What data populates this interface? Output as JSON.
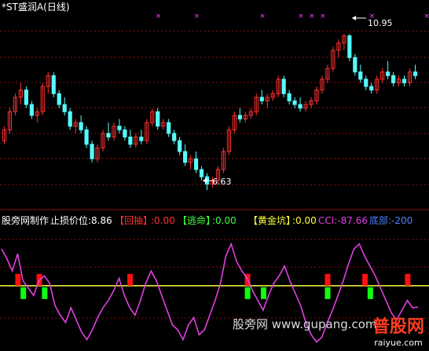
{
  "header": {
    "title": "*ST盛润A(日线)"
  },
  "colors": {
    "bg": "#000000",
    "up": "#ff3030",
    "down": "#54fcfc",
    "grid": "#8a1010",
    "magenta": "#ff40ff",
    "cci": "#e040e0",
    "zero_line": "#ffff40",
    "red_block": "#ff1010",
    "green_block": "#10ff10",
    "white": "#ffffff"
  },
  "annotations": {
    "high_label": "10.95",
    "low_label": "6.63"
  },
  "indicator_row": {
    "label_a": "股旁网制作",
    "label_b": "止损价位:8.86",
    "label_c": "【回抽】",
    "value_c": ":0.00",
    "label_d": "【逃命】",
    "value_d": ":0.00",
    "label_e": "【黄金坑】",
    "value_e": ":0.00",
    "label_f": "CCI:-87.66",
    "label_g": "底部:-200"
  },
  "watermark": {
    "text": "股旁网  www.gupang.com",
    "logo": "普股网",
    "logo_sub": "raiyue.com"
  },
  "chart_data": [
    {
      "type": "candlestick",
      "title": "*ST盛润A(日线)",
      "annotations": [
        {
          "text": "10.95",
          "kind": "high"
        },
        {
          "text": "6.63",
          "kind": "low"
        }
      ],
      "ylim": [
        6.2,
        11.5
      ],
      "candles": [
        [
          8.0,
          8.4,
          7.9,
          8.3
        ],
        [
          8.3,
          8.9,
          8.2,
          8.8
        ],
        [
          8.8,
          9.3,
          8.7,
          9.2
        ],
        [
          9.2,
          9.6,
          9.0,
          9.4
        ],
        [
          9.4,
          9.5,
          8.9,
          9.0
        ],
        [
          9.0,
          9.1,
          8.6,
          8.7
        ],
        [
          8.7,
          8.9,
          8.5,
          8.8
        ],
        [
          8.8,
          9.6,
          8.7,
          9.5
        ],
        [
          9.5,
          9.9,
          9.3,
          9.8
        ],
        [
          9.8,
          9.9,
          9.2,
          9.3
        ],
        [
          9.3,
          9.4,
          8.9,
          9.0
        ],
        [
          9.0,
          9.2,
          8.7,
          8.8
        ],
        [
          8.8,
          8.9,
          8.3,
          8.4
        ],
        [
          8.4,
          8.6,
          8.2,
          8.5
        ],
        [
          8.5,
          8.7,
          8.2,
          8.3
        ],
        [
          8.3,
          8.4,
          7.8,
          7.9
        ],
        [
          7.9,
          8.0,
          7.4,
          7.5
        ],
        [
          7.5,
          7.9,
          7.4,
          7.8
        ],
        [
          7.8,
          8.3,
          7.7,
          8.2
        ],
        [
          8.2,
          8.5,
          8.0,
          8.1
        ],
        [
          8.1,
          8.5,
          8.0,
          8.4
        ],
        [
          8.4,
          8.6,
          8.2,
          8.3
        ],
        [
          8.3,
          8.4,
          8.0,
          8.1
        ],
        [
          8.1,
          8.3,
          7.8,
          7.9
        ],
        [
          7.9,
          8.2,
          7.8,
          8.1
        ],
        [
          8.1,
          8.3,
          7.9,
          8.0
        ],
        [
          8.0,
          8.6,
          7.9,
          8.5
        ],
        [
          8.5,
          8.9,
          8.4,
          8.8
        ],
        [
          8.8,
          8.9,
          8.3,
          8.4
        ],
        [
          8.4,
          8.6,
          8.3,
          8.5
        ],
        [
          8.5,
          8.6,
          8.1,
          8.2
        ],
        [
          8.2,
          8.3,
          7.9,
          8.0
        ],
        [
          8.0,
          8.1,
          7.6,
          7.7
        ],
        [
          7.7,
          7.9,
          7.3,
          7.4
        ],
        [
          7.4,
          7.6,
          7.2,
          7.5
        ],
        [
          7.5,
          7.7,
          7.1,
          7.2
        ],
        [
          7.2,
          7.3,
          6.9,
          7.0
        ],
        [
          7.0,
          7.1,
          6.63,
          6.8
        ],
        [
          6.8,
          7.0,
          6.7,
          6.9
        ],
        [
          6.9,
          7.3,
          6.8,
          7.2
        ],
        [
          7.2,
          7.8,
          7.1,
          7.7
        ],
        [
          7.7,
          8.4,
          7.6,
          8.3
        ],
        [
          8.3,
          8.8,
          8.2,
          8.7
        ],
        [
          8.7,
          8.9,
          8.5,
          8.6
        ],
        [
          8.6,
          8.8,
          8.5,
          8.7
        ],
        [
          8.7,
          8.9,
          8.6,
          8.8
        ],
        [
          8.8,
          9.3,
          8.7,
          9.2
        ],
        [
          9.2,
          9.4,
          9.0,
          9.1
        ],
        [
          9.1,
          9.3,
          8.9,
          9.2
        ],
        [
          9.2,
          9.4,
          9.1,
          9.3
        ],
        [
          9.3,
          9.8,
          9.2,
          9.7
        ],
        [
          9.7,
          9.8,
          9.2,
          9.3
        ],
        [
          9.3,
          9.4,
          9.0,
          9.1
        ],
        [
          9.1,
          9.2,
          8.9,
          9.0
        ],
        [
          9.0,
          9.2,
          8.8,
          8.9
        ],
        [
          8.9,
          9.1,
          8.8,
          9.0
        ],
        [
          9.0,
          9.2,
          8.9,
          9.1
        ],
        [
          9.1,
          9.5,
          9.0,
          9.4
        ],
        [
          9.4,
          9.8,
          9.3,
          9.7
        ],
        [
          9.7,
          10.1,
          9.6,
          10.0
        ],
        [
          10.0,
          10.6,
          9.9,
          10.5
        ],
        [
          10.5,
          10.8,
          10.3,
          10.7
        ],
        [
          10.7,
          10.95,
          10.5,
          10.9
        ],
        [
          10.9,
          10.95,
          10.2,
          10.3
        ],
        [
          10.3,
          10.4,
          9.8,
          9.9
        ],
        [
          9.9,
          10.1,
          9.6,
          9.7
        ],
        [
          9.7,
          9.8,
          9.4,
          9.5
        ],
        [
          9.5,
          9.6,
          9.3,
          9.4
        ],
        [
          9.4,
          9.8,
          9.3,
          9.7
        ],
        [
          9.7,
          10.0,
          9.6,
          9.9
        ],
        [
          9.9,
          10.2,
          9.7,
          9.8
        ],
        [
          9.8,
          9.9,
          9.5,
          9.6
        ],
        [
          9.6,
          9.8,
          9.5,
          9.7
        ],
        [
          9.7,
          9.8,
          9.5,
          9.6
        ],
        [
          9.6,
          10.0,
          9.5,
          9.9
        ],
        [
          9.9,
          10.1,
          9.7,
          9.8
        ]
      ],
      "markers_x_index": [
        28,
        35,
        47,
        54,
        56,
        58,
        67,
        77,
        80,
        85,
        88,
        92,
        96,
        99,
        101,
        102
      ]
    },
    {
      "type": "line",
      "series": [
        {
          "name": "CCI",
          "values": [
            150,
            110,
            60,
            130,
            20,
            -10,
            -40,
            20,
            40,
            10,
            -80,
            -120,
            -150,
            -90,
            -140,
            -190,
            -220,
            -180,
            -130,
            -90,
            -60,
            -20,
            30,
            -40,
            -90,
            -120,
            -60,
            10,
            60,
            20,
            -40,
            -100,
            -160,
            -180,
            -220,
            -160,
            -130,
            -200,
            -180,
            -120,
            -60,
            10,
            120,
            170,
            100,
            60,
            30,
            -20,
            -60,
            -100,
            -40,
            10,
            40,
            80,
            20,
            -30,
            -80,
            -150,
            -200,
            -230,
            -210,
            -150,
            -100,
            -40,
            20,
            90,
            150,
            170,
            120,
            80,
            40,
            -10,
            -60,
            -110,
            -140,
            -100,
            -60,
            -90,
            -87.66
          ]
        }
      ],
      "zero_line": 0,
      "ylim": [
        -260,
        230
      ],
      "red_blocks_index": [
        3,
        7,
        24,
        46,
        61,
        68,
        76
      ],
      "green_blocks_index": [
        4,
        8,
        46,
        49,
        61,
        69
      ]
    }
  ]
}
